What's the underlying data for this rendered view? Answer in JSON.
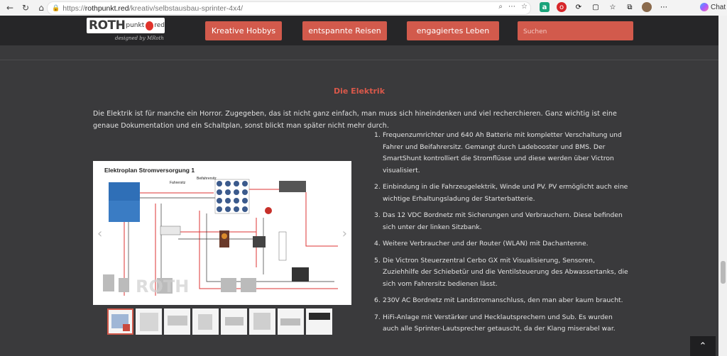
{
  "browser": {
    "url_prefix": "https://",
    "url_host": "rothpunkt.red",
    "url_path": "/kreativ/selbstausbau-sprinter-4x4/",
    "chat_label": "Chat"
  },
  "header": {
    "logo_main": "ROTH",
    "logo_punkt": "punkt",
    "logo_red": "red",
    "logo_sub": "designed by MRoth",
    "nav": [
      {
        "label": "Kreative Hobbys"
      },
      {
        "label": "entspannte Reisen"
      },
      {
        "label": "engagiertes Leben"
      }
    ],
    "search_placeholder": "Suchen"
  },
  "content": {
    "heading": "Die Elektrik",
    "intro": "Die Elektrik ist für manche ein Horror. Zugegeben, das ist nicht ganz einfach, man muss sich hineindenken und viel recherchieren. Ganz wichtig ist eine genaue Dokumentation und ein Schaltplan, sonst blickt man später nicht mehr durch.",
    "list": [
      {
        "num": "1.",
        "text": "Frequenzumrichter und 640 Ah Batterie mit kompletter Verschaltung und Fahrer und Beifahrersitz. Gemangt durch Ladebooster und BMS. Der SmartShunt kontrolliert die Stromflüsse und diese werden über Victron visualisiert."
      },
      {
        "num": "2.",
        "text": "Einbindung in die Fahrzeugelektrik, Winde und PV. PV ermöglicht auch eine wichtige Erhaltungsladung der Starterbatterie."
      },
      {
        "num": "3.",
        "text": "Das 12 VDC Bordnetz mit Sicherungen und Verbrauchern. Diese befinden sich unter der linken Sitzbank."
      },
      {
        "num": "4.",
        "text": "Weitere Verbraucher und der Router (WLAN) mit Dachantenne."
      },
      {
        "num": "5.",
        "text": "Die Victron Steuerzentral Cerbo GX mit Visualisierung, Sensoren, Zuziehhilfe der Schiebetür und die Ventilsteuerung des Abwassertanks, die sich vom Fahrersitz bedienen lässt."
      },
      {
        "num": "6.",
        "text": "230V AC Bordnetz mit Landstromanschluss, den man aber kaum braucht."
      },
      {
        "num": "7.",
        "text": "HiFi-Anlage mit Verstärker und Hecklautsprechern und Sub. Es wurden auch alle Sprinter-Lautsprecher getauscht, da der Klang miserabel war."
      }
    ],
    "slide": {
      "title": "Elektroplan Stromversorgung 1",
      "col_fahrer": "Fahrersitz",
      "col_beifahrer": "Beifahrersitz",
      "brand": "ROTH"
    }
  }
}
